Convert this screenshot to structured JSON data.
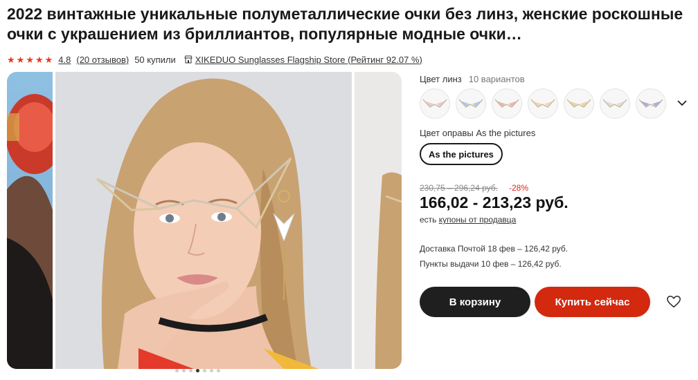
{
  "product": {
    "title": "2022 винтажные уникальные полуметаллические очки без линз, женские роскошные очки с украшением из бриллиантов, популярные модные очки…"
  },
  "meta": {
    "rating": "4.8",
    "reviews": "(20 отзывов)",
    "purchases": "50 купили",
    "store": "XIKEDUO Sunglasses Flagship Store (Рейтинг 92.07 %)",
    "star_icon": "star-icon",
    "store_icon": "store-icon",
    "star_color": "#e53b1d"
  },
  "gallery": {
    "slides": 7,
    "active_slide": 4
  },
  "options": {
    "lens_label": "Цвет линз",
    "lens_variants": "10 вариантов",
    "lens_swatch_tints": [
      "#e8b8c4",
      "#9bb7e6",
      "#e8a09a",
      "#efc9a8",
      "#e2c98a",
      "#d6d6d6",
      "#9a8fd8"
    ],
    "frame_label": "Цвет оправы As the pictures",
    "frame_selected": "As the pictures"
  },
  "pricing": {
    "old_range": "230,75 – 296,24 руб.",
    "discount": "-28%",
    "current_range": "166,02 - 213,23 руб.",
    "coupons_prefix": "есть",
    "coupons_link": "купоны от продавца",
    "accent": "#e1251b"
  },
  "delivery": {
    "post": "Доставка Почтой 18 фев – 126,42 руб.",
    "pickup": "Пункты выдачи 10 фев – 126,42 руб."
  },
  "actions": {
    "cart": "В корзину",
    "buy_now": "Купить сейчас",
    "wishlist_icon": "heart-icon",
    "buy_color": "#d3290f",
    "cart_color": "#1f1f1f"
  }
}
